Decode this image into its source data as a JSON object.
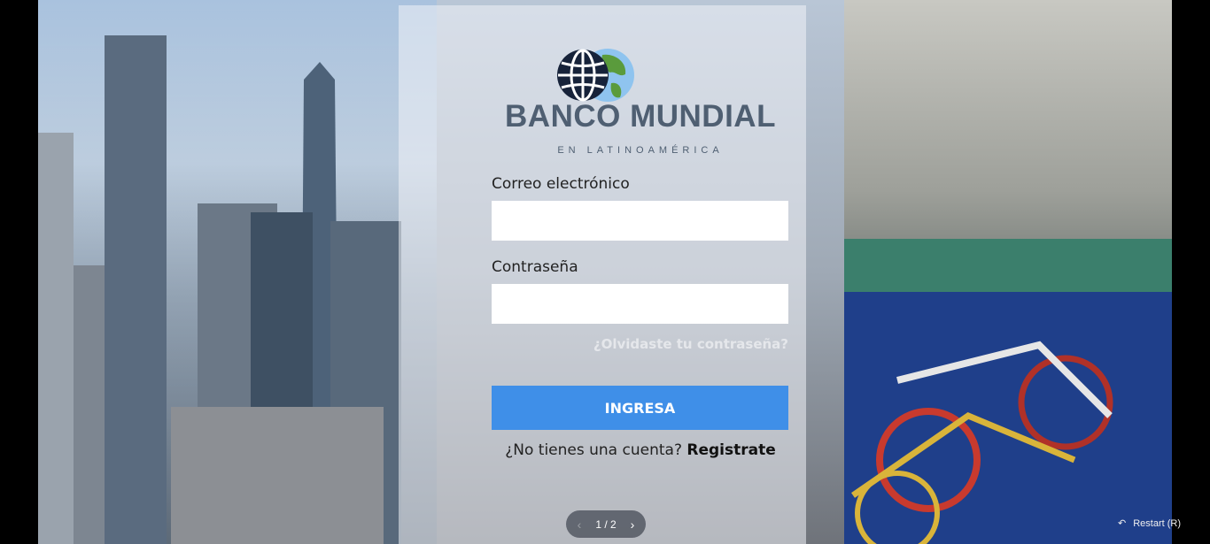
{
  "brand": {
    "title": "BANCO MUNDIAL",
    "subtitle": "EN LATINOAMÉRICA",
    "colors": {
      "text": "#4f5f72",
      "globe_dark": "#17233a",
      "globe_land": "#5a9b3c",
      "globe_sea": "#8fc4ef"
    }
  },
  "form": {
    "email_label": "Correo electrónico",
    "email_value": "",
    "email_placeholder": "",
    "password_label": "Contraseña",
    "password_value": "",
    "password_placeholder": "",
    "forgot_link": "¿Olvidaste tu contraseña?",
    "submit_label": "INGRESA",
    "submit_color": "#3f8fe8"
  },
  "signup": {
    "prompt": "¿No tienes una cuenta?",
    "link": "Registrate"
  },
  "pager": {
    "indicator": "1 / 2",
    "prev_icon": "chevron-left-icon",
    "next_icon": "chevron-right-icon"
  },
  "restart": {
    "label": "Restart (R)",
    "icon": "undo-arrow-icon"
  }
}
